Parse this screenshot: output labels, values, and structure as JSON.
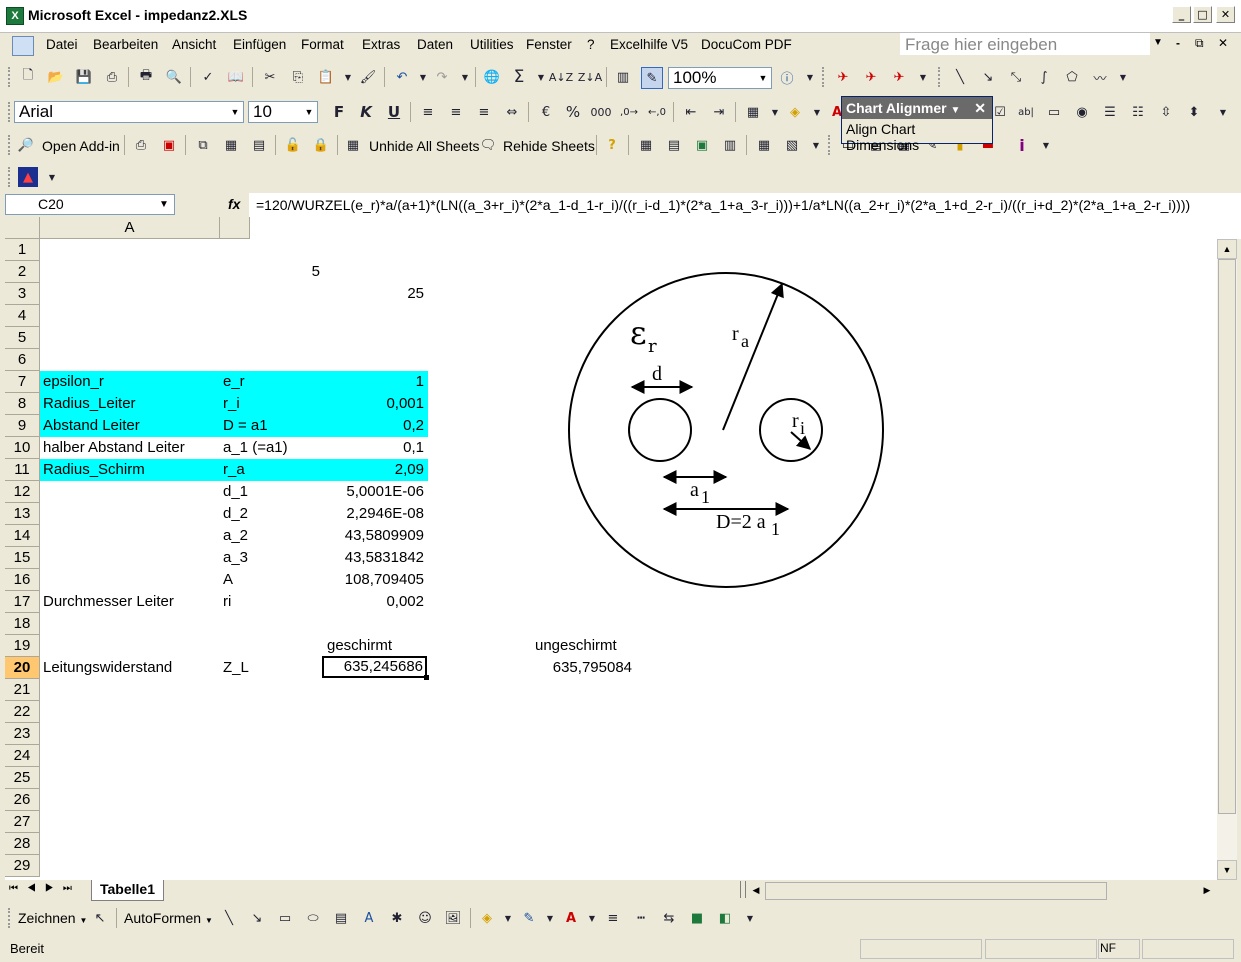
{
  "window": {
    "title": "Microsoft Excel - impedanz2.XLS"
  },
  "menu": {
    "items": [
      "Datei",
      "Bearbeiten",
      "Ansicht",
      "Einfügen",
      "Format",
      "Extras",
      "Daten",
      "Utilities",
      "Fenster",
      "?",
      "Excelhilfe V5",
      "DocuCom PDF"
    ],
    "ask_placeholder": "Frage hier eingeben"
  },
  "toolbar": {
    "zoom": "100%",
    "font": "Arial",
    "size": "10",
    "bold": "F",
    "italic": "K",
    "underline": "U",
    "open_addin": "Open Add-in",
    "unhide": "Unhide All Sheets",
    "rehide": "Rehide Sheets"
  },
  "chart_alignmer": {
    "title": "Chart Alignmer",
    "item": "Align Chart Dimensions"
  },
  "formula_bar": {
    "name": "C20",
    "fx": "fx",
    "formula": "=120/WURZEL(e_r)*a/(a+1)*(LN((a_3+r_i)*(2*a_1-d_1-r_i)/((r_i-d_1)*(2*a_1+a_3-r_i)))+1/a*LN((a_2+r_i)*(2*a_1+d_2-r_i)/((r_i+d_2)*(2*a_1+a_2-r_i))))"
  },
  "sheet": {
    "col_a": "A",
    "rows": [
      "1",
      "2",
      "3",
      "4",
      "5",
      "6",
      "7",
      "8",
      "9",
      "10",
      "11",
      "12",
      "13",
      "14",
      "15",
      "16",
      "17",
      "18",
      "19",
      "20",
      "21",
      "22",
      "23",
      "24",
      "25",
      "26",
      "27",
      "28",
      "29"
    ],
    "cells": {
      "r2c": "5",
      "r3c": "25",
      "r7a": "epsilon_r",
      "r7b": "e_r",
      "r7c": "1",
      "r8a": "Radius_Leiter",
      "r8b": "r_i",
      "r8c": "0,001",
      "r9a": "Abstand Leiter",
      "r9b": "D = a1",
      "r9c": "0,2",
      "r10a": "halber Abstand Leiter",
      "r10b": "a_1 (=a1)",
      "r10c": "0,1",
      "r11a": "Radius_Schirm",
      "r11b": "r_a",
      "r11c": "2,09",
      "r12b": "d_1",
      "r12c": "5,0001E-06",
      "r13b": "d_2",
      "r13c": "2,2946E-08",
      "r14b": "a_2",
      "r14c": "43,5809909",
      "r15b": "a_3",
      "r15c": "43,5831842",
      "r16b": "A",
      "r16c": "108,709405",
      "r17a": "Durchmesser Leiter",
      "r17b": "ri",
      "r17c": "0,002",
      "r19c": "geschirmt",
      "r19d": "ungeschirmt",
      "r20a": "Leitungswiderstand",
      "r20b": "Z_L",
      "r20c": "635,245686",
      "r20d": "635,795084"
    }
  },
  "diagram": {
    "eps": "ε",
    "eps_sub": "r",
    "ra": "r",
    "ra_sub": "a",
    "d": "d",
    "ri": "r",
    "ri_sub": "i",
    "a1": "a",
    "a1_sub": "1",
    "D": "D=2 a",
    "D_sub": "1"
  },
  "tabs": {
    "sheet1": "Tabelle1"
  },
  "drawing": {
    "zeichnen": "Zeichnen",
    "autoformen": "AutoFormen"
  },
  "status": {
    "ready": "Bereit",
    "nf": "NF"
  }
}
